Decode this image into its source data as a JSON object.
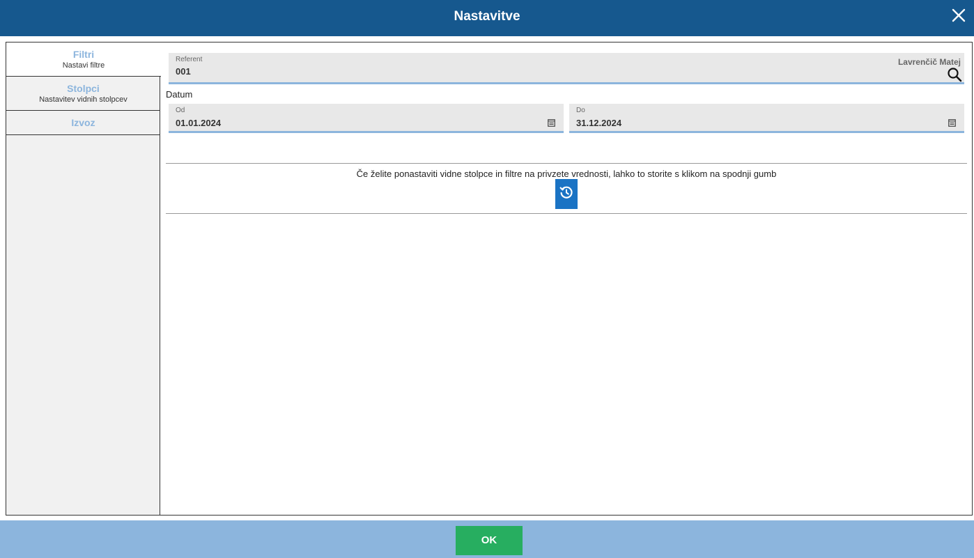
{
  "dialog": {
    "title": "Nastavitve"
  },
  "icons": {
    "close": "close-icon",
    "search": "search-icon",
    "calendar": "calendar-icon",
    "reset": "history-icon"
  },
  "colors": {
    "header": "#16588e",
    "footer": "#8cb5dd",
    "ok": "#27ae60",
    "accent": "#1a73c4",
    "tab_label": "#8cb5dd"
  },
  "sidebar": {
    "tabs": [
      {
        "label": "Filtri",
        "sub": "Nastavi filtre",
        "active": true
      },
      {
        "label": "Stolpci",
        "sub": "Nastavitev vidnih stolpcev",
        "active": false
      },
      {
        "label": "Izvoz",
        "sub": "",
        "active": false
      }
    ]
  },
  "filters": {
    "referent": {
      "label": "Referent",
      "value": "001",
      "name": "Lavrenčič Matej"
    },
    "datum_label": "Datum",
    "od": {
      "label": "Od",
      "value": "01.01.2024"
    },
    "do": {
      "label": "Do",
      "value": "31.12.2024"
    }
  },
  "reset": {
    "text": "Če želite ponastaviti vidne stolpce in filtre na privzete vrednosti, lahko to storite s klikom na spodnji gumb"
  },
  "footer": {
    "ok_label": "OK"
  }
}
